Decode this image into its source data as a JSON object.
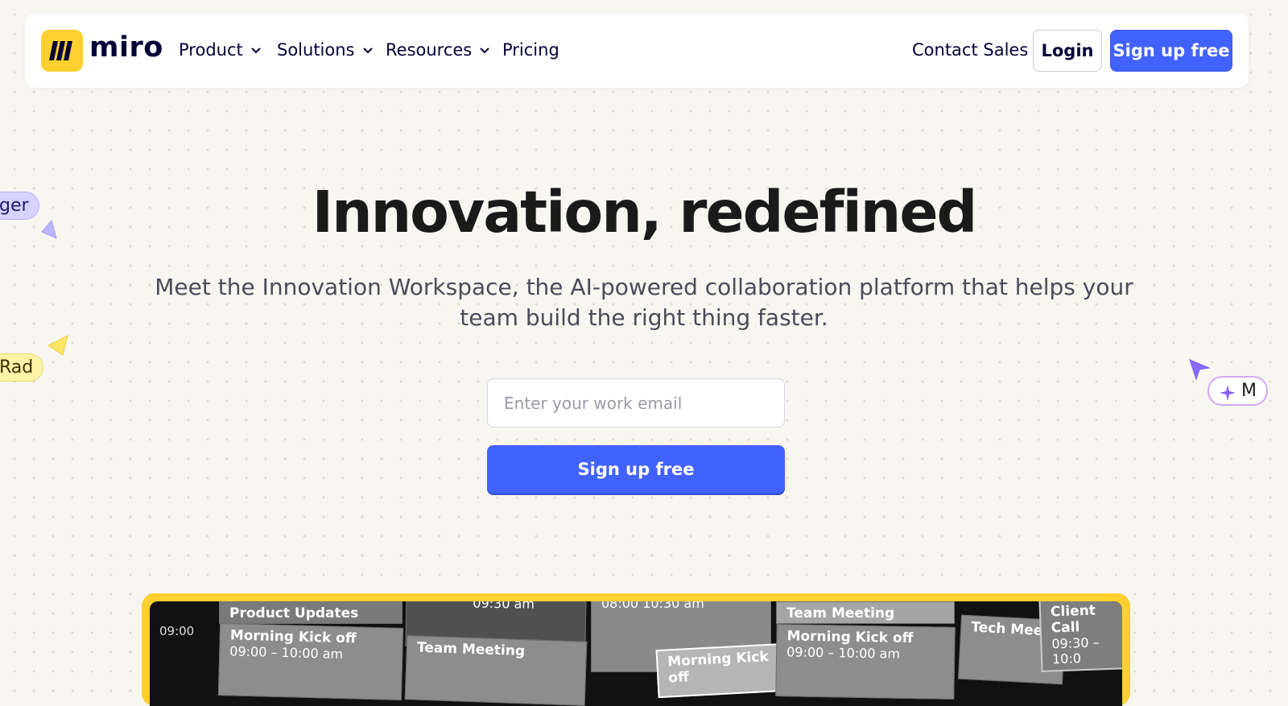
{
  "nav": {
    "logo_text": "miro",
    "items": [
      {
        "label": "Product",
        "has_dropdown": true
      },
      {
        "label": "Solutions",
        "has_dropdown": true
      },
      {
        "label": "Resources",
        "has_dropdown": true
      },
      {
        "label": "Pricing",
        "has_dropdown": false
      }
    ],
    "contact_sales": "Contact Sales",
    "login": "Login",
    "signup": "Sign up free"
  },
  "hero": {
    "title": "Innovation, redefined",
    "subtitle": "Meet the Innovation Workspace, the AI-powered collaboration platform that helps your team build the right thing faster.",
    "email_placeholder": "Enter your work email",
    "email_value": "",
    "cta": "Sign up free"
  },
  "floating_tags": {
    "purple": "ger",
    "yellow": "Rad",
    "ai": "M"
  },
  "preview": {
    "time": "09:00",
    "cards": [
      {
        "title": "Product Updates",
        "time": ""
      },
      {
        "title": "Morning Kick off",
        "time": "09:00 – 10:00 am"
      },
      {
        "title": "",
        "time": "09:30 am"
      },
      {
        "title": "Team Meeting",
        "time": ""
      },
      {
        "title": "",
        "time": "08:00  10:30 am"
      },
      {
        "title": "Morning Kick off",
        "time": ""
      },
      {
        "title": "Team Meeting",
        "time": ""
      },
      {
        "title": "Morning Kick off",
        "time": "09:00 – 10:00 am"
      },
      {
        "title": "Tech Meeti",
        "time": ""
      },
      {
        "title": "Client Call",
        "time": "09:30 – 10:0"
      },
      {
        "title": "Team Meeting",
        "time": ""
      }
    ]
  },
  "colors": {
    "brand_yellow": "#ffd02f",
    "brand_blue": "#4262ff",
    "ink": "#050038",
    "background": "#f8f6f1"
  },
  "icons": [
    "miro-logo-icon",
    "chevron-down-icon",
    "cursor-arrow-icon",
    "sparkle-icon"
  ]
}
